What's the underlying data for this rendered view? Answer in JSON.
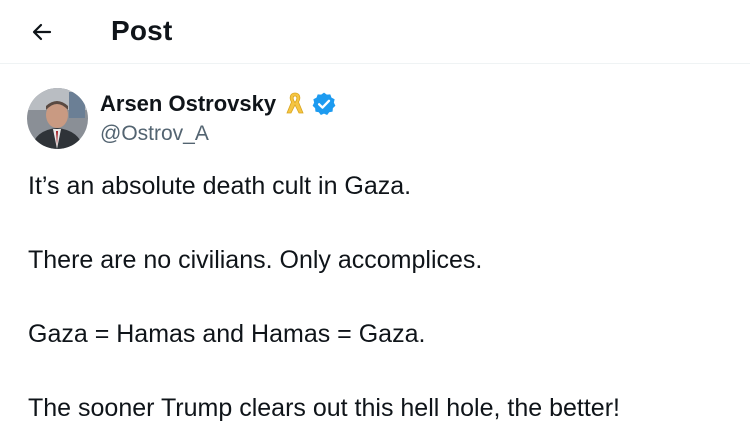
{
  "header": {
    "back_icon": "arrow-left-icon",
    "title": "Post"
  },
  "author": {
    "display_name": "Arsen Ostrovsky",
    "handle": "@Ostrov_A",
    "ribbon_icon": "yellow-ribbon-icon",
    "ribbon_color": "#f5c542",
    "verified_icon": "verified-badge-icon",
    "verified_color": "#1d9bf0"
  },
  "tweet": {
    "lines": [
      "It’s an absolute death cult in Gaza.",
      "There are no civilians. Only accomplices.",
      "Gaza = Hamas and Hamas = Gaza.",
      "The sooner Trump clears out this hell hole, the better!"
    ]
  },
  "colors": {
    "text_primary": "#0f1419",
    "text_secondary": "#536471",
    "background": "#ffffff"
  }
}
